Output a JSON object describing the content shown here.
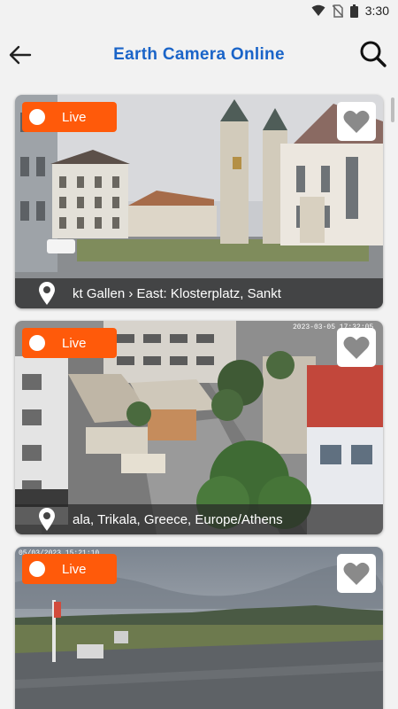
{
  "status_bar": {
    "time": "3:30",
    "icons": [
      "wifi-icon",
      "no-sim-icon",
      "battery-icon"
    ]
  },
  "app_bar": {
    "title": "Earth Camera Online",
    "back_icon": "arrow-left-icon",
    "search_icon": "search-icon"
  },
  "colors": {
    "accent": "#1a64c8",
    "live_badge": "#ff5a0a",
    "background": "#f2f2f2"
  },
  "cameras": [
    {
      "live_label": "Live",
      "location": "kt Gallen › East: Klosterplatz, Sankt",
      "favorite_icon": "heart-icon",
      "pin_icon": "location-pin-icon"
    },
    {
      "live_label": "Live",
      "location": "ala, Trikala, Greece, Europe/Athens",
      "overlay_timestamp": "2023-03-05 17:32:05",
      "favorite_icon": "heart-icon",
      "pin_icon": "location-pin-icon"
    },
    {
      "live_label": "Live",
      "overlay_timestamp": "05/03/2023 15:21:10",
      "favorite_icon": "heart-icon"
    }
  ]
}
